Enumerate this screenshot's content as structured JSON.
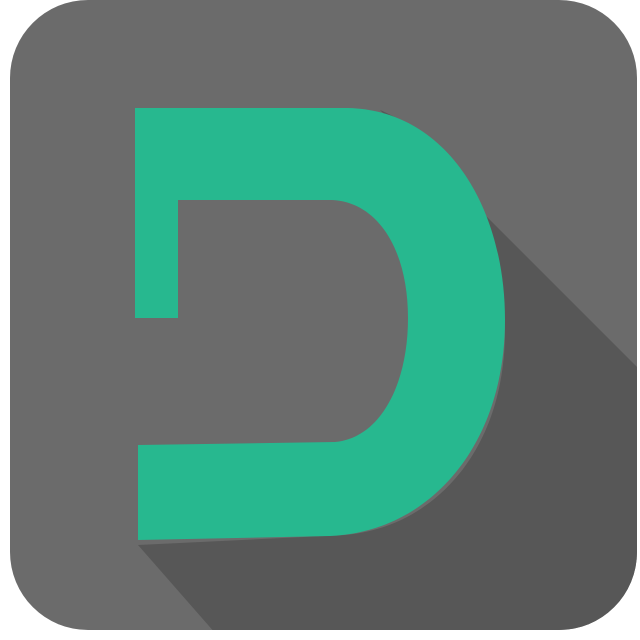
{
  "icon": {
    "name": "d-letter-icon",
    "colors": {
      "background": "#6b6b6b",
      "long_shadow": "#575757",
      "letter": "#27b88f",
      "page": "#ffffff"
    }
  }
}
